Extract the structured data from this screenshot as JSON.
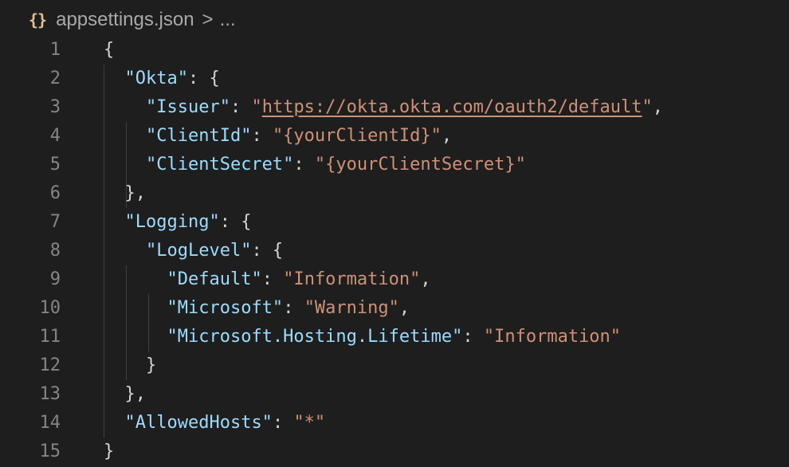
{
  "breadcrumb": {
    "file_icon": "{}",
    "file_name": "appsettings.json",
    "separator": ">",
    "ellipsis": "..."
  },
  "editor": {
    "language": "json",
    "line_numbers": [
      "1",
      "2",
      "3",
      "4",
      "5",
      "6",
      "7",
      "8",
      "9",
      "10",
      "11",
      "12",
      "13",
      "14",
      "15"
    ],
    "lines": [
      {
        "tokens": [
          {
            "t": "p",
            "v": "{"
          }
        ]
      },
      {
        "tokens": [
          {
            "t": "ind",
            "v": "  "
          },
          {
            "t": "k",
            "v": "\"Okta\""
          },
          {
            "t": "p",
            "v": ": {"
          }
        ]
      },
      {
        "tokens": [
          {
            "t": "ind",
            "v": "    "
          },
          {
            "t": "k",
            "v": "\"Issuer\""
          },
          {
            "t": "p",
            "v": ": "
          },
          {
            "t": "s",
            "v": "\""
          },
          {
            "t": "s url",
            "v": "https://okta.okta.com/oauth2/default"
          },
          {
            "t": "s",
            "v": "\""
          },
          {
            "t": "p",
            "v": ","
          }
        ]
      },
      {
        "tokens": [
          {
            "t": "ind",
            "v": "    "
          },
          {
            "t": "k",
            "v": "\"ClientId\""
          },
          {
            "t": "p",
            "v": ": "
          },
          {
            "t": "s",
            "v": "\"{yourClientId}\""
          },
          {
            "t": "p",
            "v": ","
          }
        ]
      },
      {
        "tokens": [
          {
            "t": "ind",
            "v": "    "
          },
          {
            "t": "k",
            "v": "\"ClientSecret\""
          },
          {
            "t": "p",
            "v": ": "
          },
          {
            "t": "s",
            "v": "\"{yourClientSecret}\""
          }
        ]
      },
      {
        "tokens": [
          {
            "t": "ind",
            "v": "  "
          },
          {
            "t": "p",
            "v": "},"
          }
        ]
      },
      {
        "tokens": [
          {
            "t": "ind",
            "v": "  "
          },
          {
            "t": "k",
            "v": "\"Logging\""
          },
          {
            "t": "p",
            "v": ": {"
          }
        ]
      },
      {
        "tokens": [
          {
            "t": "ind",
            "v": "    "
          },
          {
            "t": "k",
            "v": "\"LogLevel\""
          },
          {
            "t": "p",
            "v": ": {"
          }
        ]
      },
      {
        "tokens": [
          {
            "t": "ind",
            "v": "      "
          },
          {
            "t": "k",
            "v": "\"Default\""
          },
          {
            "t": "p",
            "v": ": "
          },
          {
            "t": "s",
            "v": "\"Information\""
          },
          {
            "t": "p",
            "v": ","
          }
        ]
      },
      {
        "tokens": [
          {
            "t": "ind",
            "v": "      "
          },
          {
            "t": "k",
            "v": "\"Microsoft\""
          },
          {
            "t": "p",
            "v": ": "
          },
          {
            "t": "s",
            "v": "\"Warning\""
          },
          {
            "t": "p",
            "v": ","
          }
        ]
      },
      {
        "tokens": [
          {
            "t": "ind",
            "v": "      "
          },
          {
            "t": "k",
            "v": "\"Microsoft.Hosting.Lifetime\""
          },
          {
            "t": "p",
            "v": ": "
          },
          {
            "t": "s",
            "v": "\"Information\""
          }
        ]
      },
      {
        "tokens": [
          {
            "t": "ind",
            "v": "    "
          },
          {
            "t": "p",
            "v": "}"
          }
        ]
      },
      {
        "tokens": [
          {
            "t": "ind",
            "v": "  "
          },
          {
            "t": "p",
            "v": "},"
          }
        ]
      },
      {
        "tokens": [
          {
            "t": "ind",
            "v": "  "
          },
          {
            "t": "k",
            "v": "\"AllowedHosts\""
          },
          {
            "t": "p",
            "v": ": "
          },
          {
            "t": "s",
            "v": "\"*\""
          }
        ]
      },
      {
        "tokens": [
          {
            "t": "p",
            "v": "}"
          }
        ]
      }
    ]
  },
  "colors": {
    "background": "#1e1e1e",
    "line_number": "#858585",
    "json_key": "#9cdcfe",
    "json_string": "#ce9178",
    "punctuation": "#d4d4d4",
    "json_file_icon": "#e2c08d",
    "indent_guide": "#404040"
  }
}
